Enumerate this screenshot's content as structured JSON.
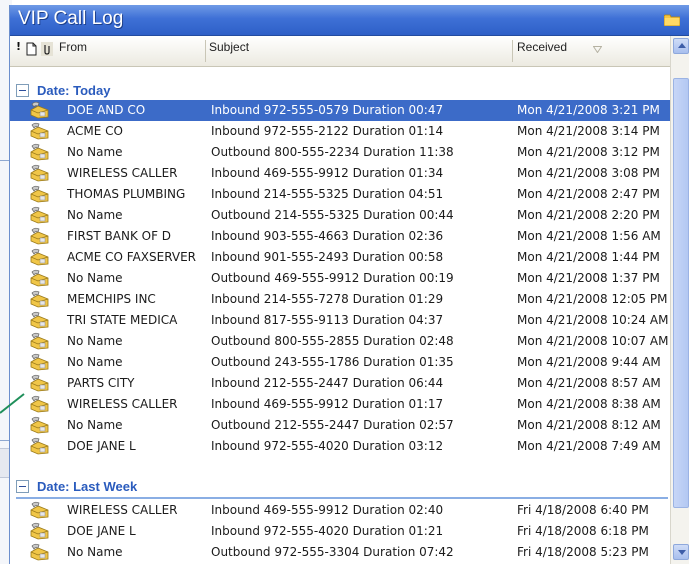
{
  "window": {
    "title": "VIP Call Log"
  },
  "columns": {
    "from": "From",
    "subject": "Subject",
    "received": "Received"
  },
  "colors": {
    "titlebar": "#3e70d6",
    "selected": "#3c6bc8",
    "group_text": "#2a5bbd"
  },
  "groups": [
    {
      "label": "Date: Today",
      "rows": [
        {
          "from": "DOE AND CO",
          "subject": "Inbound  972-555-0579  Duration  00:47",
          "received": "Mon 4/21/2008 3:21 PM",
          "selected": true
        },
        {
          "from": "ACME CO",
          "subject": "Inbound  972-555-2122  Duration  01:14",
          "received": "Mon 4/21/2008 3:14 PM"
        },
        {
          "from": "No Name",
          "subject": "Outbound  800-555-2234  Duration  11:38",
          "received": "Mon 4/21/2008 3:12 PM"
        },
        {
          "from": "WIRELESS CALLER",
          "subject": "Inbound  469-555-9912  Duration  01:34",
          "received": "Mon 4/21/2008 3:08 PM"
        },
        {
          "from": "THOMAS PLUMBING",
          "subject": "Inbound  214-555-5325  Duration  04:51",
          "received": "Mon 4/21/2008 2:47 PM"
        },
        {
          "from": "No Name",
          "subject": "Outbound  214-555-5325  Duration  00:44",
          "received": "Mon 4/21/2008 2:20 PM"
        },
        {
          "from": "FIRST BANK OF D",
          "subject": "Inbound  903-555-4663  Duration  02:36",
          "received": "Mon 4/21/2008 1:56 AM"
        },
        {
          "from": "ACME CO FAXSERVER",
          "subject": "Inbound  901-555-2493  Duration  00:58",
          "received": "Mon 4/21/2008 1:44 PM"
        },
        {
          "from": "No Name",
          "subject": "Outbound  469-555-9912  Duration  00:19",
          "received": "Mon 4/21/2008 1:37 PM"
        },
        {
          "from": "MEMCHIPS INC",
          "subject": "Inbound  214-555-7278  Duration  01:29",
          "received": "Mon 4/21/2008 12:05 PM"
        },
        {
          "from": "TRI STATE MEDICA",
          "subject": "Inbound  817-555-9113  Duration  04:37",
          "received": "Mon 4/21/2008 10:24 AM"
        },
        {
          "from": "No Name",
          "subject": "Outbound  800-555-2855  Duration  02:48",
          "received": "Mon 4/21/2008 10:07 AM"
        },
        {
          "from": "No Name",
          "subject": "Outbound  243-555-1786  Duration  01:35",
          "received": "Mon 4/21/2008 9:44 AM"
        },
        {
          "from": "PARTS CITY",
          "subject": "Inbound  212-555-2447  Duration  06:44",
          "received": "Mon 4/21/2008 8:57 AM"
        },
        {
          "from": "WIRELESS CALLER",
          "subject": "Inbound  469-555-9912  Duration  01:17",
          "received": "Mon 4/21/2008 8:38 AM"
        },
        {
          "from": "No Name",
          "subject": "Outbound  212-555-2447  Duration  02:57",
          "received": "Mon 4/21/2008 8:12 AM"
        },
        {
          "from": "DOE JANE L",
          "subject": "Inbound  972-555-4020  Duration  03:12",
          "received": "Mon 4/21/2008 7:49 AM"
        }
      ]
    },
    {
      "label": "Date: Last Week",
      "rows": [
        {
          "from": "WIRELESS CALLER",
          "subject": "Inbound  469-555-9912  Duration  02:40",
          "received": "Fri 4/18/2008 6:40 PM"
        },
        {
          "from": "DOE JANE L",
          "subject": "Inbound  972-555-4020  Duration  01:21",
          "received": "Fri 4/18/2008 6:18 PM"
        },
        {
          "from": "No Name",
          "subject": "Outbound  972-555-3304  Duration  07:42",
          "received": "Fri 4/18/2008 5:23 PM"
        }
      ]
    }
  ]
}
